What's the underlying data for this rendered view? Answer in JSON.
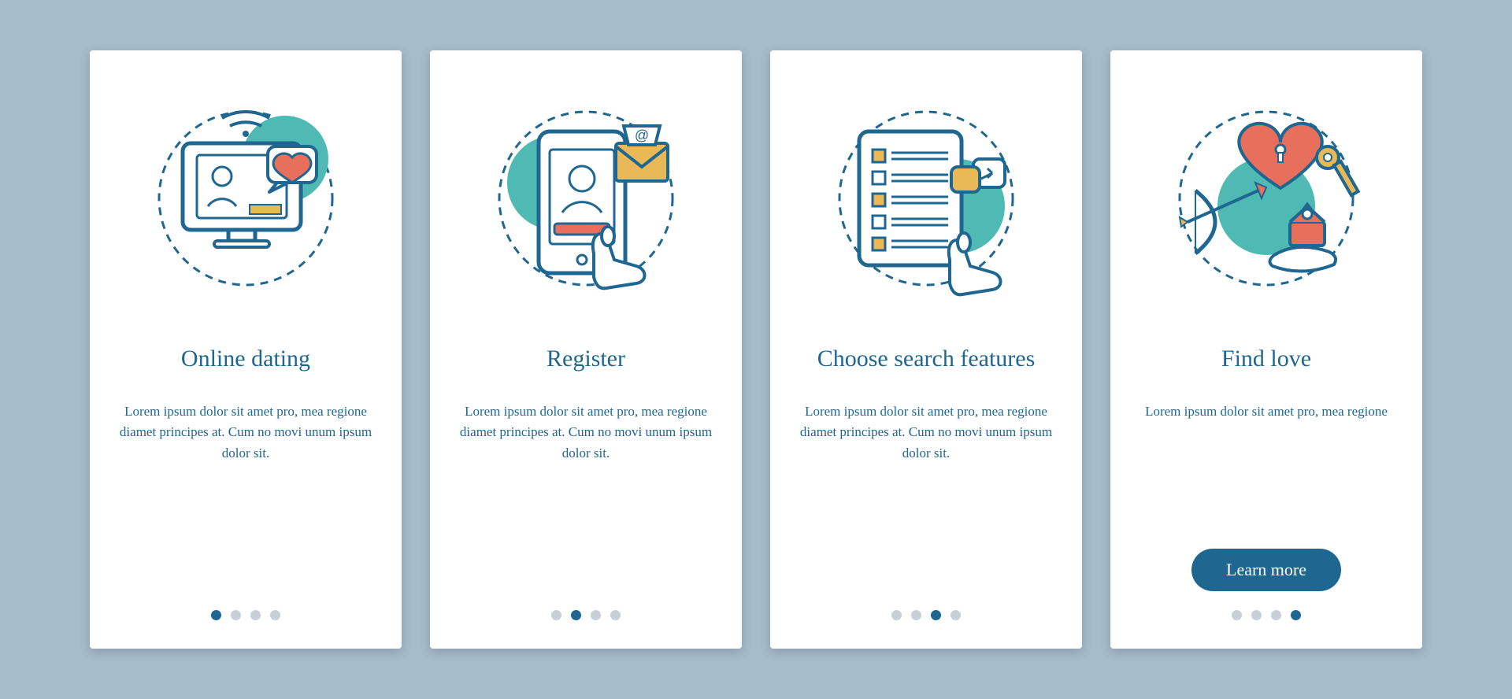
{
  "colors": {
    "bg": "#a6bcc9",
    "primary": "#1f6790",
    "accent_teal": "#4fb9b3",
    "accent_coral": "#e86f5c",
    "accent_gold": "#e8b956",
    "dot_inactive": "#c9cfd4"
  },
  "cta_label": "Learn more",
  "cards": [
    {
      "key": "online-dating",
      "title": "Online dating",
      "body": "Lorem ipsum dolor sit amet pro, mea regione diamet principes at. Cum no movi unum ipsum dolor sit.",
      "active_dot": 0,
      "has_cta": false
    },
    {
      "key": "register",
      "title": "Register",
      "body": "Lorem ipsum dolor sit amet pro, mea regione diamet principes at. Cum no movi unum ipsum dolor sit.",
      "active_dot": 1,
      "has_cta": false
    },
    {
      "key": "choose-search",
      "title": "Choose search features",
      "body": "Lorem ipsum dolor sit amet pro, mea regione diamet principes at. Cum no movi unum ipsum dolor sit.",
      "active_dot": 2,
      "has_cta": false
    },
    {
      "key": "find-love",
      "title": "Find love",
      "body": "Lorem ipsum dolor sit amet pro, mea regione",
      "active_dot": 3,
      "has_cta": true
    }
  ]
}
